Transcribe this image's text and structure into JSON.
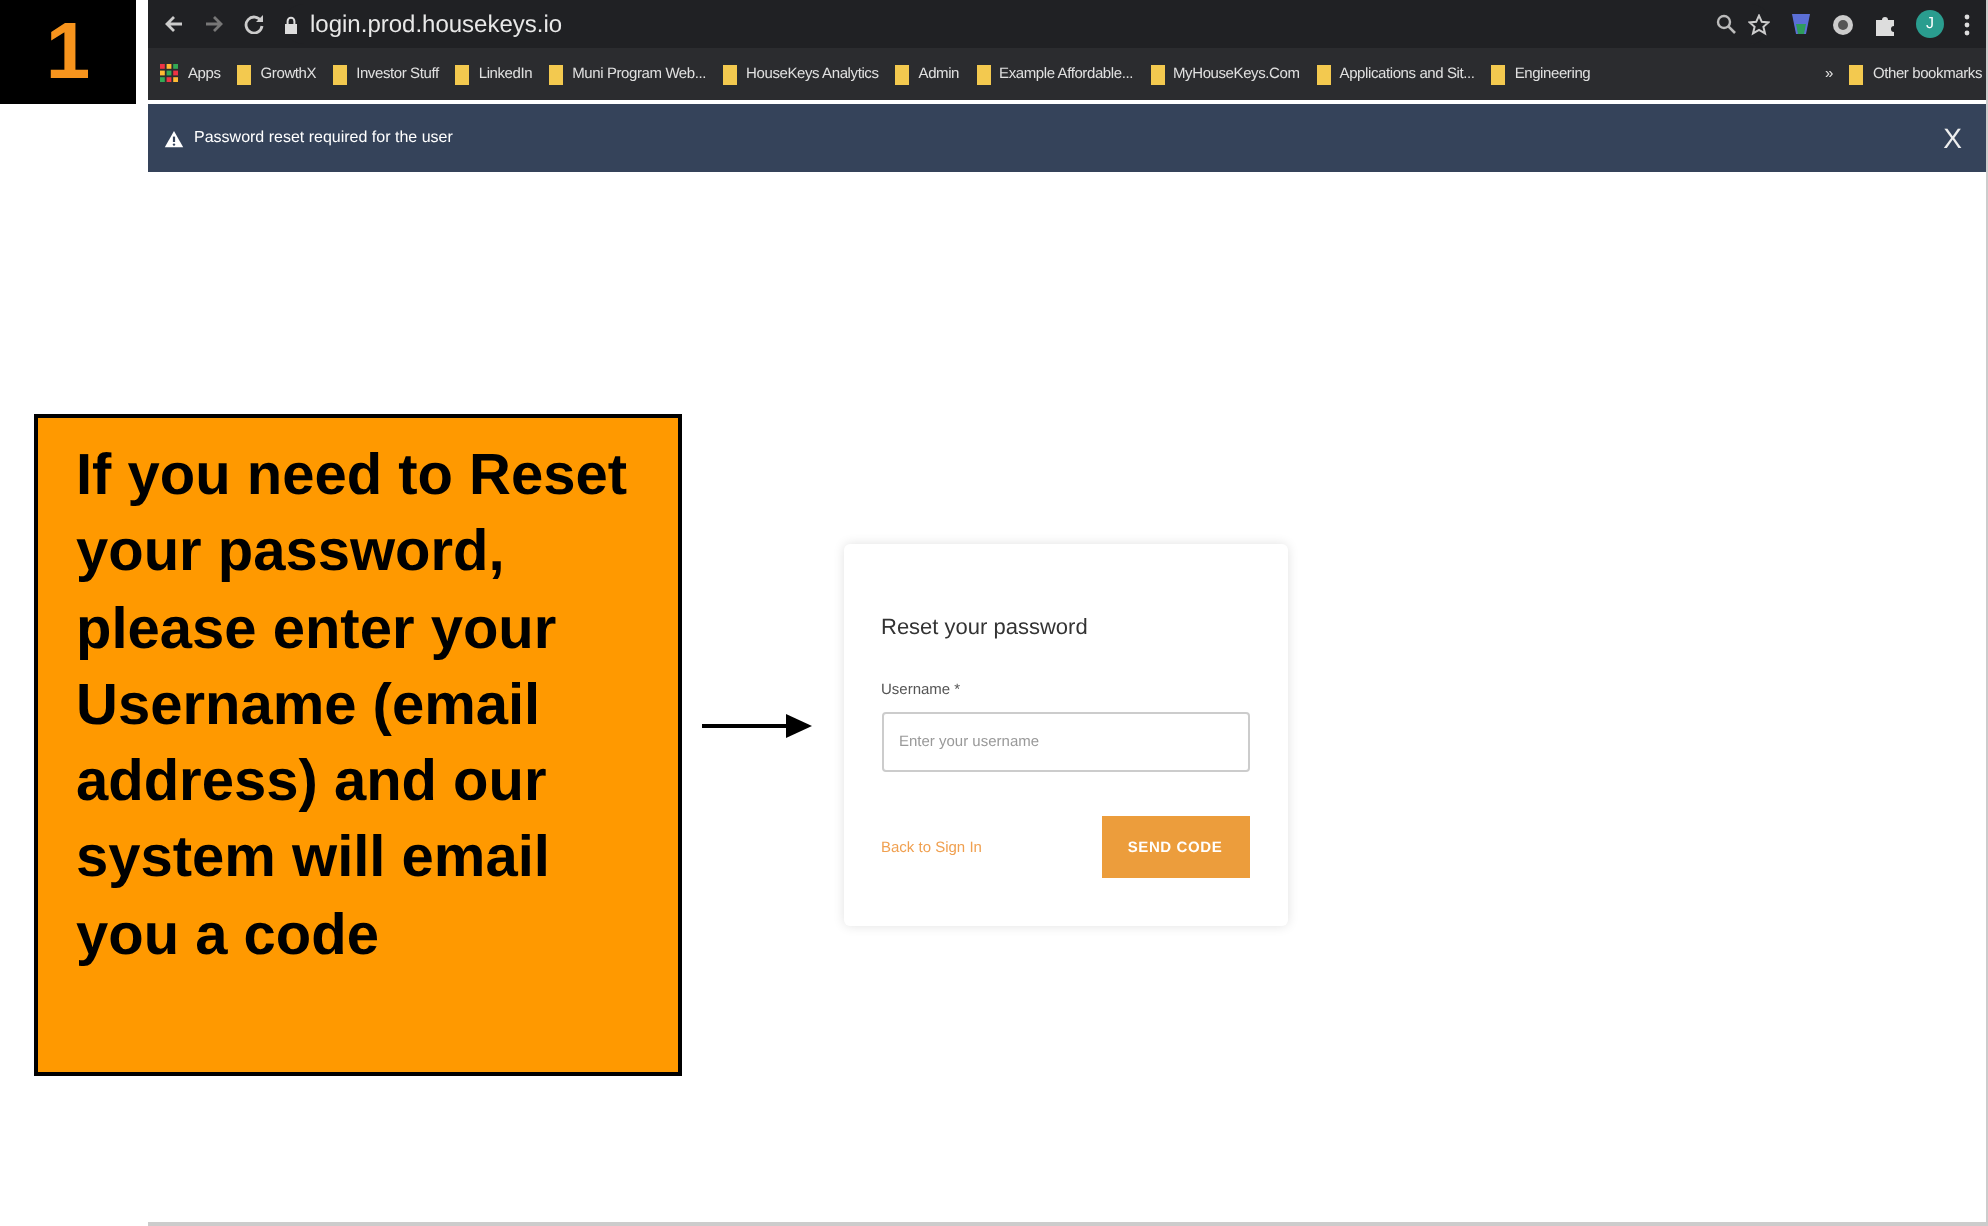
{
  "step_badge": "1",
  "browser": {
    "url": "login.prod.housekeys.io",
    "profile_initial": "J",
    "bookmarks": [
      {
        "label": "Apps",
        "kind": "apps"
      },
      {
        "label": "GrowthX",
        "kind": "folder"
      },
      {
        "label": "Investor Stuff",
        "kind": "folder"
      },
      {
        "label": "LinkedIn",
        "kind": "folder"
      },
      {
        "label": "Muni Program Web...",
        "kind": "folder"
      },
      {
        "label": "HouseKeys Analytics",
        "kind": "folder"
      },
      {
        "label": "Admin",
        "kind": "folder"
      },
      {
        "label": "Example Affordable...",
        "kind": "folder"
      },
      {
        "label": "MyHouseKeys.Com",
        "kind": "folder"
      },
      {
        "label": "Applications and Sit...",
        "kind": "folder"
      },
      {
        "label": "Engineering",
        "kind": "folder"
      }
    ],
    "more": "»",
    "other_bookmarks": "Other bookmarks"
  },
  "alert": {
    "message": "Password reset required for the user",
    "close": "X"
  },
  "form": {
    "title": "Reset your password",
    "field_label": "Username *",
    "placeholder": "Enter your username",
    "back_link": "Back to Sign In",
    "submit": "SEND CODE"
  },
  "callout": {
    "text": "If you need to Reset your password, please enter your Username (email address) and our system will email you a code"
  }
}
